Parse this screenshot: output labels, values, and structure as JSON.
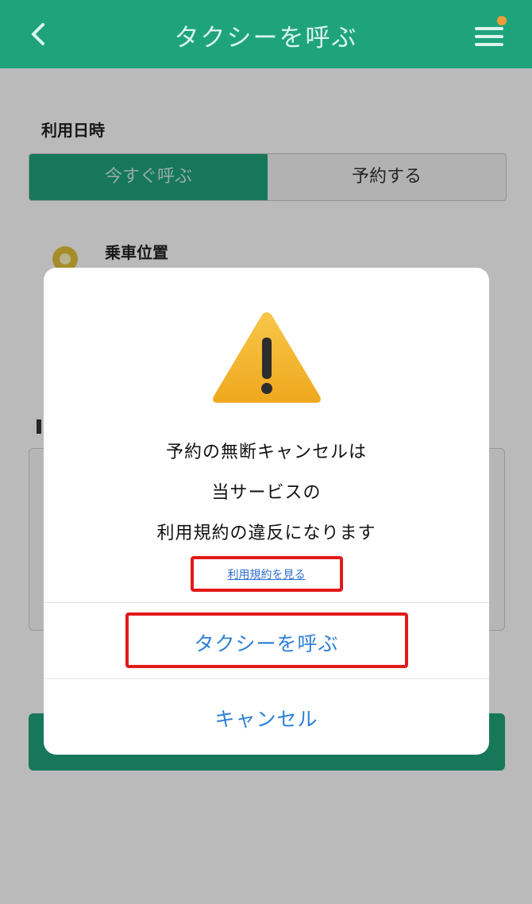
{
  "header": {
    "title": "タクシーを呼ぶ"
  },
  "form": {
    "datetime_label": "利用日時",
    "segments": [
      "今すぐ呼ぶ",
      "予約する"
    ],
    "pickup_label": "乗車位置"
  },
  "dialog": {
    "message_lines": [
      "予約の無断キャンセルは",
      "当サービスの",
      "利用規約の違反になります"
    ],
    "terms_link": "利用規約を見る",
    "confirm_button": "タクシーを呼ぶ",
    "cancel_button": "キャンセル"
  },
  "colors": {
    "brand": "#1fa37b",
    "link": "#2f80d6",
    "highlight": "#e11a1a",
    "warning": "#f5b731"
  },
  "icons": [
    "back-icon",
    "menu-icon",
    "pin-icon",
    "warning-icon"
  ]
}
